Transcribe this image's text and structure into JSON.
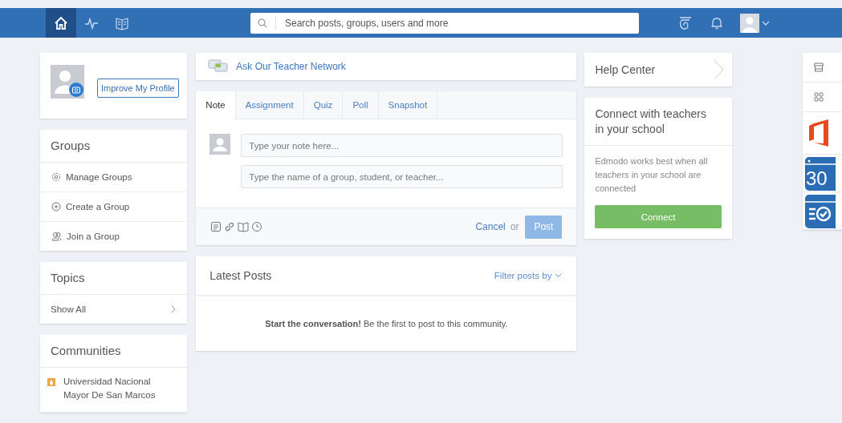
{
  "nav": {
    "tabs": [
      {
        "kind": "home",
        "selected": true
      },
      {
        "kind": "activity",
        "selected": false
      },
      {
        "kind": "library",
        "selected": false
      }
    ],
    "search": {
      "placeholder": "Search posts, groups, users and more"
    }
  },
  "profile": {
    "button": "Improve My Profile"
  },
  "groups": {
    "title": "Groups",
    "items": [
      {
        "kind": "manage",
        "label": "Manage Groups"
      },
      {
        "kind": "create",
        "label": "Create a Group"
      },
      {
        "kind": "join",
        "label": "Join a Group"
      }
    ]
  },
  "topics": {
    "title": "Topics",
    "link": "Show All"
  },
  "communities": {
    "title": "Communities",
    "items": [
      {
        "name": "Universidad Nacional Mayor De San Marcos",
        "color": "#f0a348"
      }
    ]
  },
  "ask": {
    "label": "Ask Our Teacher Network"
  },
  "composer": {
    "tabs": [
      {
        "label": "Note",
        "selected": true
      },
      {
        "label": "Assignment",
        "selected": false
      },
      {
        "label": "Quiz",
        "selected": false
      },
      {
        "label": "Poll",
        "selected": false
      },
      {
        "label": "Snapshot",
        "selected": false
      }
    ],
    "note_placeholder": "Type your note here...",
    "recipient_placeholder": "Type the name of a group, student, or teacher...",
    "tools": [
      {
        "kind": "file"
      },
      {
        "kind": "link"
      },
      {
        "kind": "library"
      },
      {
        "kind": "clock"
      }
    ],
    "cancel": "Cancel",
    "or": "or",
    "post": {
      "label": "Post",
      "disabled": true
    }
  },
  "latest": {
    "title": "Latest Posts",
    "filter": "Filter posts by",
    "empty": "**Start the conversation!** Be the first to post to this community."
  },
  "help": {
    "title": "Help Center"
  },
  "connect": {
    "title": "Connect with teachers in your school",
    "text": "Edmodo works best when all teachers in your school are connected",
    "button": "Connect"
  },
  "apps": [
    {
      "kind": "store"
    },
    {
      "kind": "grid"
    },
    {
      "kind": "office"
    },
    {
      "kind": "calendar",
      "label": "30"
    },
    {
      "kind": "check"
    }
  ]
}
